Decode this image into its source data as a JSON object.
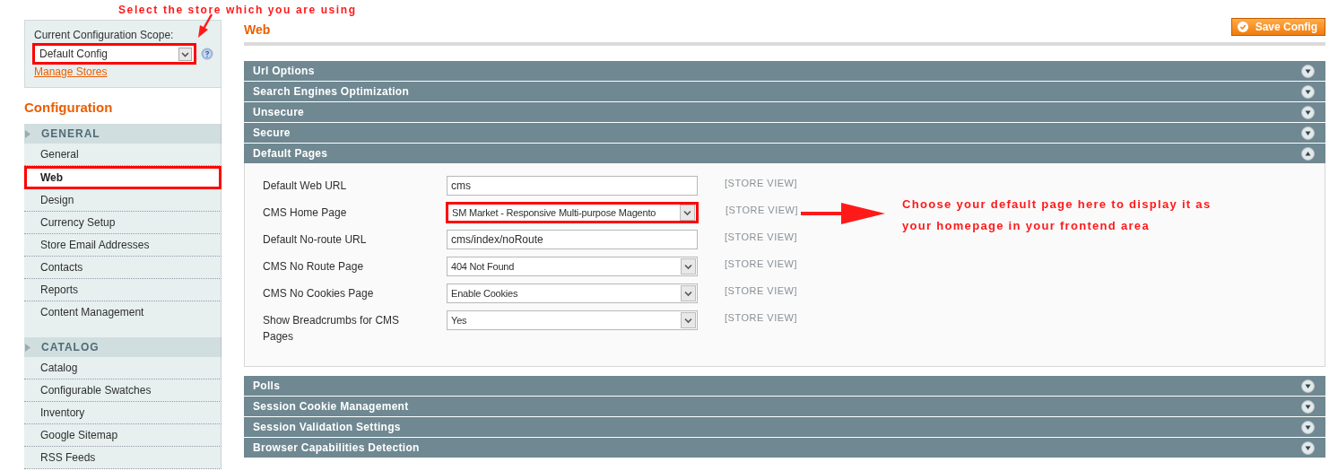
{
  "top_note": "Select the store which you are using",
  "scope": {
    "label": "Current Configuration Scope:",
    "value": "Default Config",
    "highlighted": true,
    "link": "Manage Stores"
  },
  "sidebar": {
    "title": "Configuration",
    "groups": [
      {
        "label": "GENERAL",
        "items": [
          {
            "label": "General",
            "selected": false,
            "highlighted": false
          },
          {
            "label": "Web",
            "selected": true,
            "highlighted": true
          },
          {
            "label": "Design",
            "selected": false,
            "highlighted": false
          },
          {
            "label": "Currency Setup",
            "selected": false,
            "highlighted": false
          },
          {
            "label": "Store Email Addresses",
            "selected": false,
            "highlighted": false
          },
          {
            "label": "Contacts",
            "selected": false,
            "highlighted": false
          },
          {
            "label": "Reports",
            "selected": false,
            "highlighted": false
          },
          {
            "label": "Content Management",
            "selected": false,
            "highlighted": false
          }
        ]
      },
      {
        "label": "CATALOG",
        "items": [
          {
            "label": "Catalog",
            "selected": false,
            "highlighted": false
          },
          {
            "label": "Configurable Swatches",
            "selected": false,
            "highlighted": false
          },
          {
            "label": "Inventory",
            "selected": false,
            "highlighted": false
          },
          {
            "label": "Google Sitemap",
            "selected": false,
            "highlighted": false
          },
          {
            "label": "RSS Feeds",
            "selected": false,
            "highlighted": false
          }
        ]
      }
    ]
  },
  "page_title": "Web",
  "save_button": "Save Config",
  "sections": [
    {
      "title": "Url Options",
      "expanded": false
    },
    {
      "title": "Search Engines Optimization",
      "expanded": false
    },
    {
      "title": "Unsecure",
      "expanded": false
    },
    {
      "title": "Secure",
      "expanded": false
    },
    {
      "title": "Default Pages",
      "expanded": true,
      "fields": [
        {
          "kind": "text",
          "label": "Default Web URL",
          "value": "cms",
          "scope": "[STORE VIEW]",
          "highlighted": false
        },
        {
          "kind": "select",
          "label": "CMS Home Page",
          "value": "SM Market - Responsive Multi-purpose Magento",
          "scope": "[STORE VIEW]",
          "highlighted": true
        },
        {
          "kind": "text",
          "label": "Default No-route URL",
          "value": "cms/index/noRoute",
          "scope": "[STORE VIEW]",
          "highlighted": false
        },
        {
          "kind": "select",
          "label": "CMS No Route Page",
          "value": "404 Not Found",
          "scope": "[STORE VIEW]",
          "highlighted": false
        },
        {
          "kind": "select",
          "label": "CMS No Cookies Page",
          "value": "Enable Cookies",
          "scope": "[STORE VIEW]",
          "highlighted": false
        },
        {
          "kind": "select",
          "label": "Show  Breadcrumbs for CMS Pages",
          "value": "Yes",
          "scope": "[STORE VIEW]",
          "highlighted": false
        }
      ]
    },
    {
      "title": "Polls",
      "expanded": false
    },
    {
      "title": "Session Cookie Management",
      "expanded": false
    },
    {
      "title": "Session Validation Settings",
      "expanded": false
    },
    {
      "title": "Browser Capabilities Detection",
      "expanded": false
    }
  ],
  "side_note": {
    "lines": [
      "Choose your default page here to display it as",
      "your homepage in your frontend area"
    ]
  }
}
